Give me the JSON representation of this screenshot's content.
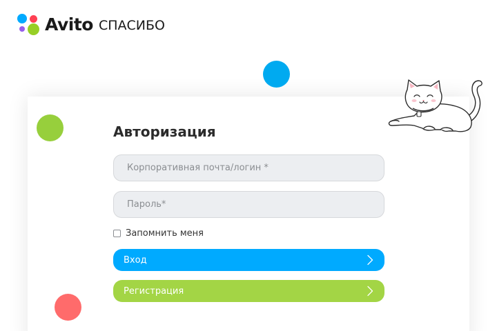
{
  "header": {
    "logo_word": "Avito",
    "logo_sub": "СПАСИБО"
  },
  "login_form": {
    "title": "Авторизация",
    "login_placeholder": "Корпоративная почта/логин *",
    "password_placeholder": "Пароль*",
    "remember_label": "Запомнить меня",
    "remember_checked": false,
    "login_button": "Вход",
    "register_button": "Регистрация"
  },
  "colors": {
    "brand_blue": "#00aaff",
    "brand_green": "#a3d545",
    "brand_red": "#ff6b6b",
    "brand_purple": "#965eeb"
  },
  "icons": {
    "button_arrow": "chevron-right-icon",
    "mascot": "cat-illustration"
  }
}
